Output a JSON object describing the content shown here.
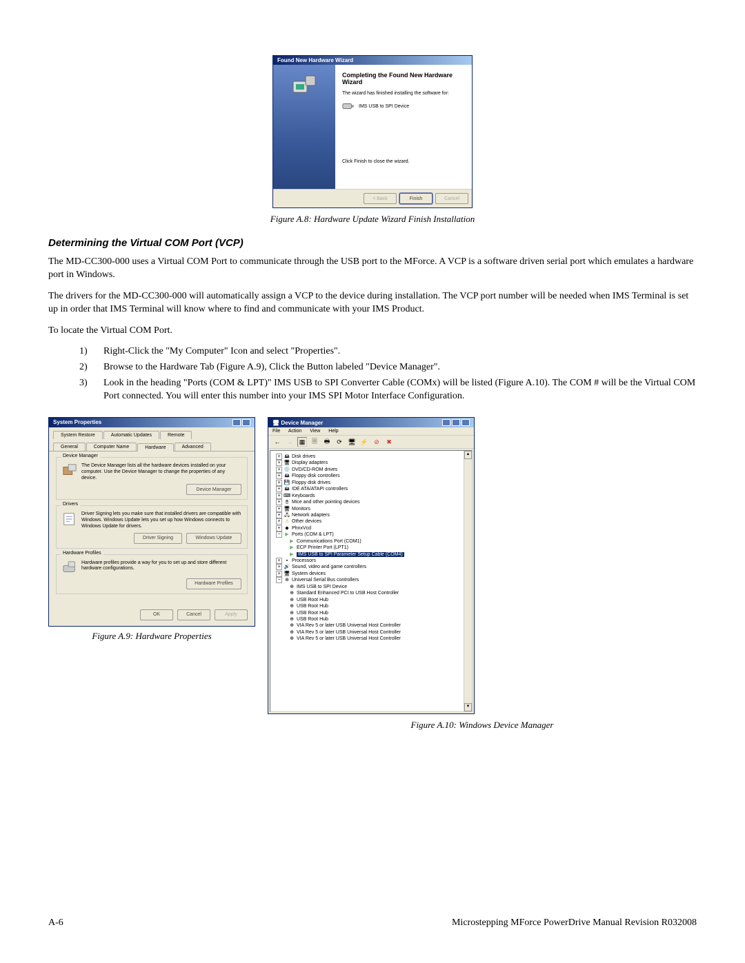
{
  "wizard": {
    "title": "Found New Hardware Wizard",
    "heading": "Completing the Found New Hardware Wizard",
    "text": "The wizard has finished installing the software for:",
    "device": "IMS USB to SPI Device",
    "finishHint": "Click Finish to close the wizard.",
    "buttons": {
      "back": "< Back",
      "finish": "Finish",
      "cancel": "Cancel"
    }
  },
  "captions": {
    "a8": "Figure A.8: Hardware Update Wizard Finish Installation",
    "a9": "Figure A.9: Hardware Properties",
    "a10": "Figure A.10: Windows Device Manager"
  },
  "section": {
    "heading": "Determining the Virtual COM Port (VCP)"
  },
  "paras": {
    "p1": "The MD-CC300-000 uses a Virtual COM Port to communicate through the USB port to the MForce. A VCP is a software driven serial port which emulates a hardware port in Windows.",
    "p2": "The drivers for the MD-CC300-000 will automatically assign a VCP to the device during installation. The VCP port number will be needed when IMS Terminal is set up in order that IMS Terminal will know where to find and communicate with your IMS Product.",
    "p3": "To locate the Virtual COM Port."
  },
  "steps": {
    "s1n": "1)",
    "s1": "Right-Click the \"My Computer\" Icon and select \"Properties\".",
    "s2n": "2)",
    "s2": "Browse to the Hardware Tab (Figure A.9), Click the Button labeled \"Device Manager\".",
    "s3n": "3)",
    "s3": "Look in the heading \"Ports (COM & LPT)\" IMS USB to SPI Converter Cable (COMx) will be listed (Figure A.10). The COM # will be the Virtual COM Port connected. You will enter this number into your IMS SPI Motor Interface Configuration."
  },
  "sysprop": {
    "title": "System Properties",
    "tabs": {
      "t1": "System Restore",
      "t2": "Automatic Updates",
      "t3": "Remote",
      "t4": "General",
      "t5": "Computer Name",
      "t6": "Hardware",
      "t7": "Advanced"
    },
    "dm": {
      "label": "Device Manager",
      "text": "The Device Manager lists all the hardware devices installed on your computer. Use the Device Manager to change the properties of any device.",
      "btn": "Device Manager"
    },
    "drv": {
      "label": "Drivers",
      "text": "Driver Signing lets you make sure that installed drivers are compatible with Windows. Windows Update lets you set up how Windows connects to Windows Update for drivers.",
      "btn1": "Driver Signing",
      "btn2": "Windows Update"
    },
    "hp": {
      "label": "Hardware Profiles",
      "text": "Hardware profiles provide a way for you to set up and store different hardware configurations.",
      "btn": "Hardware Profiles"
    },
    "bottom": {
      "ok": "OK",
      "cancel": "Cancel",
      "apply": "Apply"
    }
  },
  "devmgr": {
    "title": "Device Manager",
    "menu": {
      "file": "File",
      "action": "Action",
      "view": "View",
      "help": "Help"
    },
    "nodes": {
      "disk": "Disk drives",
      "display": "Display adapters",
      "dvd": "DVD/CD-ROM drives",
      "fdc": "Floppy disk controllers",
      "fdd": "Floppy disk drives",
      "ide": "IDE ATA/ATAPI controllers",
      "kbd": "Keyboards",
      "mice": "Mice and other pointing devices",
      "mon": "Monitors",
      "net": "Network adapters",
      "other": "Other devices",
      "phnx": "PhnxVcd",
      "ports": "Ports (COM & LPT)",
      "com1": "Communications Port (COM1)",
      "lpt1": "ECP Printer Port (LPT1)",
      "ims": "IMS USB to SPI Parameter Setup Cable (COM4)",
      "proc": "Processors",
      "svg": "Sound, video and game controllers",
      "sysd": "System devices",
      "usb": "Universal Serial Bus controllers",
      "usb1": "IMS USB to SPI Device",
      "usb2": "Standard Enhanced PCI to USB Host Controller",
      "usb3": "USB Root Hub",
      "usb4": "USB Root Hub",
      "usb5": "USB Root Hub",
      "usb6": "USB Root Hub",
      "usb7": "VIA Rev 5 or later USB Universal Host Controller",
      "usb8": "VIA Rev 5 or later USB Universal Host Controller",
      "usb9": "VIA Rev 5 or later USB Universal Host Controller"
    }
  },
  "footer": {
    "left": "A-6",
    "right": "Microstepping MForce PowerDrive Manual Revision R032008"
  }
}
